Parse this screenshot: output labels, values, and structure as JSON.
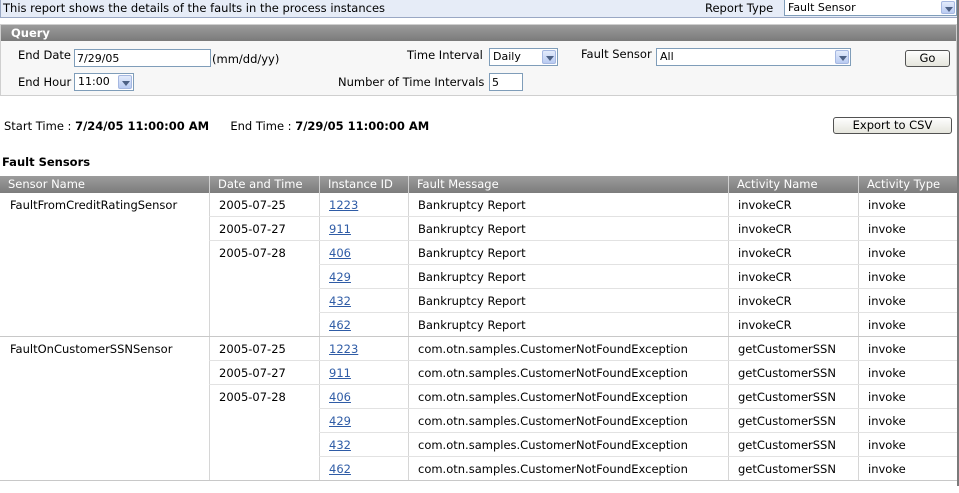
{
  "banner": {
    "description": "This report shows the details of the faults in the process instances",
    "report_type_label": "Report Type",
    "report_type_value": "Fault Sensor"
  },
  "query": {
    "title": "Query",
    "end_date_label": "End Date",
    "end_date_value": "7/29/05",
    "end_date_format": "(mm/dd/yy)",
    "end_hour_label": "End Hour",
    "end_hour_value": "11:00",
    "time_interval_label": "Time Interval",
    "time_interval_value": "Daily",
    "num_intervals_label": "Number of Time Intervals",
    "num_intervals_value": "5",
    "fault_sensor_label": "Fault Sensor",
    "fault_sensor_value": "All",
    "go_label": "Go"
  },
  "range": {
    "start_label": "Start Time :",
    "start_value": "7/24/05 11:00:00 AM",
    "end_label": "End Time :",
    "end_value": "7/29/05 11:00:00 AM",
    "export_label": "Export to CSV"
  },
  "section_title": "Fault Sensors",
  "table": {
    "columns": [
      "Sensor Name",
      "Date and Time",
      "Instance ID",
      "Fault Message",
      "Activity Name",
      "Activity Type"
    ],
    "rows": [
      {
        "sensor": "FaultFromCreditRatingSensor",
        "date": "2005-07-25",
        "id": "1223",
        "msg": "Bankruptcy Report",
        "activity": "invokeCR",
        "type": "invoke"
      },
      {
        "sensor": "",
        "date": "2005-07-27",
        "id": "911",
        "msg": "Bankruptcy Report",
        "activity": "invokeCR",
        "type": "invoke"
      },
      {
        "sensor": "",
        "date": "2005-07-28",
        "id": "406",
        "msg": "Bankruptcy Report",
        "activity": "invokeCR",
        "type": "invoke"
      },
      {
        "sensor": "",
        "date": "",
        "id": "429",
        "msg": "Bankruptcy Report",
        "activity": "invokeCR",
        "type": "invoke"
      },
      {
        "sensor": "",
        "date": "",
        "id": "432",
        "msg": "Bankruptcy Report",
        "activity": "invokeCR",
        "type": "invoke"
      },
      {
        "sensor": "",
        "date": "",
        "id": "462",
        "msg": "Bankruptcy Report",
        "activity": "invokeCR",
        "type": "invoke"
      },
      {
        "sensor": "FaultOnCustomerSSNSensor",
        "date": "2005-07-25",
        "id": "1223",
        "msg": "com.otn.samples.CustomerNotFoundException",
        "activity": "getCustomerSSN",
        "type": "invoke"
      },
      {
        "sensor": "",
        "date": "2005-07-27",
        "id": "911",
        "msg": "com.otn.samples.CustomerNotFoundException",
        "activity": "getCustomerSSN",
        "type": "invoke"
      },
      {
        "sensor": "",
        "date": "2005-07-28",
        "id": "406",
        "msg": "com.otn.samples.CustomerNotFoundException",
        "activity": "getCustomerSSN",
        "type": "invoke"
      },
      {
        "sensor": "",
        "date": "",
        "id": "429",
        "msg": "com.otn.samples.CustomerNotFoundException",
        "activity": "getCustomerSSN",
        "type": "invoke"
      },
      {
        "sensor": "",
        "date": "",
        "id": "432",
        "msg": "com.otn.samples.CustomerNotFoundException",
        "activity": "getCustomerSSN",
        "type": "invoke"
      },
      {
        "sensor": "",
        "date": "",
        "id": "462",
        "msg": "com.otn.samples.CustomerNotFoundException",
        "activity": "getCustomerSSN",
        "type": "invoke"
      }
    ]
  },
  "colors": {
    "banner_bg": "#e6ecf7",
    "header_gray": "#8a8a8a",
    "link_blue": "#2f5ca6"
  }
}
